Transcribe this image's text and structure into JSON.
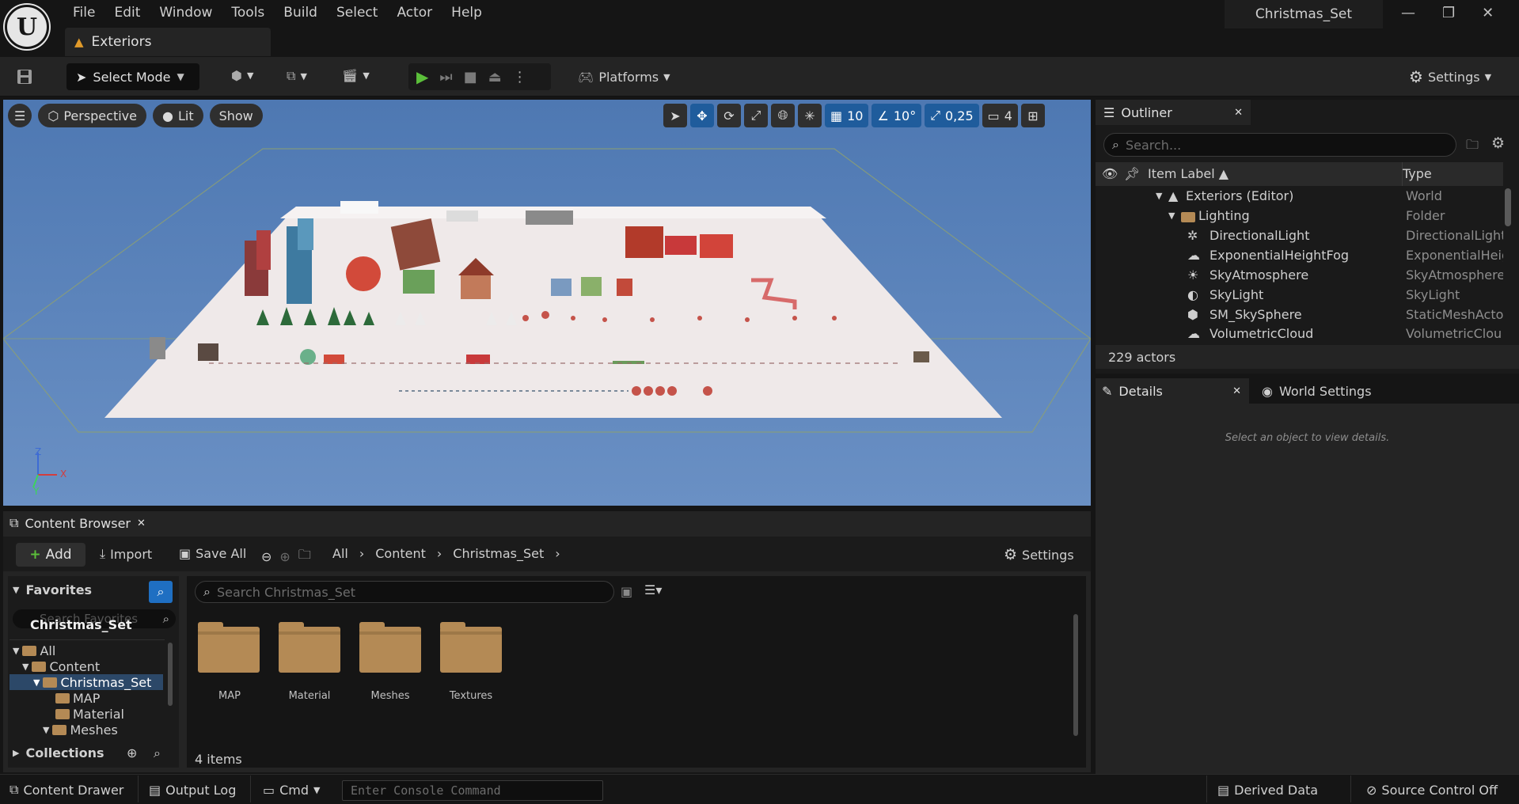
{
  "menu": [
    "File",
    "Edit",
    "Window",
    "Tools",
    "Build",
    "Select",
    "Actor",
    "Help"
  ],
  "doc_tab": "Exteriors",
  "project_title": "Christmas_Set",
  "toolbar": {
    "select_mode": "Select Mode",
    "platforms": "Platforms",
    "settings": "Settings"
  },
  "viewport": {
    "perspective": "Perspective",
    "lit": "Lit",
    "show": "Show",
    "grid_snap": "10",
    "rotation_snap": "10°",
    "scale_snap": "0,25",
    "camera_speed": "4",
    "axis": {
      "z": "Z",
      "x": "X",
      "y": "Y"
    }
  },
  "outliner": {
    "tab": "Outliner",
    "search_placeholder": "Search...",
    "col_label": "Item Label ▲",
    "col_type": "Type",
    "rows": [
      {
        "label": "Exteriors (Editor)",
        "type": "World"
      },
      {
        "label": "Lighting",
        "type": "Folder"
      },
      {
        "label": "DirectionalLight",
        "type": "DirectionalLight"
      },
      {
        "label": "ExponentialHeightFog",
        "type": "ExponentialHeig"
      },
      {
        "label": "SkyAtmosphere",
        "type": "SkyAtmosphere"
      },
      {
        "label": "SkyLight",
        "type": "SkyLight"
      },
      {
        "label": "SM_SkySphere",
        "type": "StaticMeshActo"
      },
      {
        "label": "VolumetricCloud",
        "type": "VolumetricClou"
      }
    ],
    "actor_count": "229 actors"
  },
  "details": {
    "tab": "Details",
    "world_settings_tab": "World Settings",
    "hint": "Select an object to view details."
  },
  "content_browser": {
    "tab": "Content Browser",
    "add": "Add",
    "import": "Import",
    "save_all": "Save All",
    "breadcrumb": [
      "All",
      "Content",
      "Christmas_Set"
    ],
    "settings": "Settings",
    "favorites": "Favorites",
    "favorites_search_placeholder": "Search Favorites",
    "collection_root": "Christmas_Set",
    "tree": [
      "All",
      "Content",
      "Christmas_Set",
      "MAP",
      "Material",
      "Meshes"
    ],
    "collections": "Collections",
    "search_placeholder": "Search Christmas_Set",
    "folders": [
      "MAP",
      "Material",
      "Meshes",
      "Textures"
    ],
    "item_count": "4 items"
  },
  "statusbar": {
    "content_drawer": "Content Drawer",
    "output_log": "Output Log",
    "cmd": "Cmd",
    "console_placeholder": "Enter Console Command",
    "derived_data": "Derived Data",
    "source_control": "Source Control Off"
  },
  "colors": {
    "viewport_sky": "#5c84bb",
    "accent_blue": "#1f5c9c",
    "play_green": "#5bbf3a",
    "folder": "#b48a55"
  }
}
